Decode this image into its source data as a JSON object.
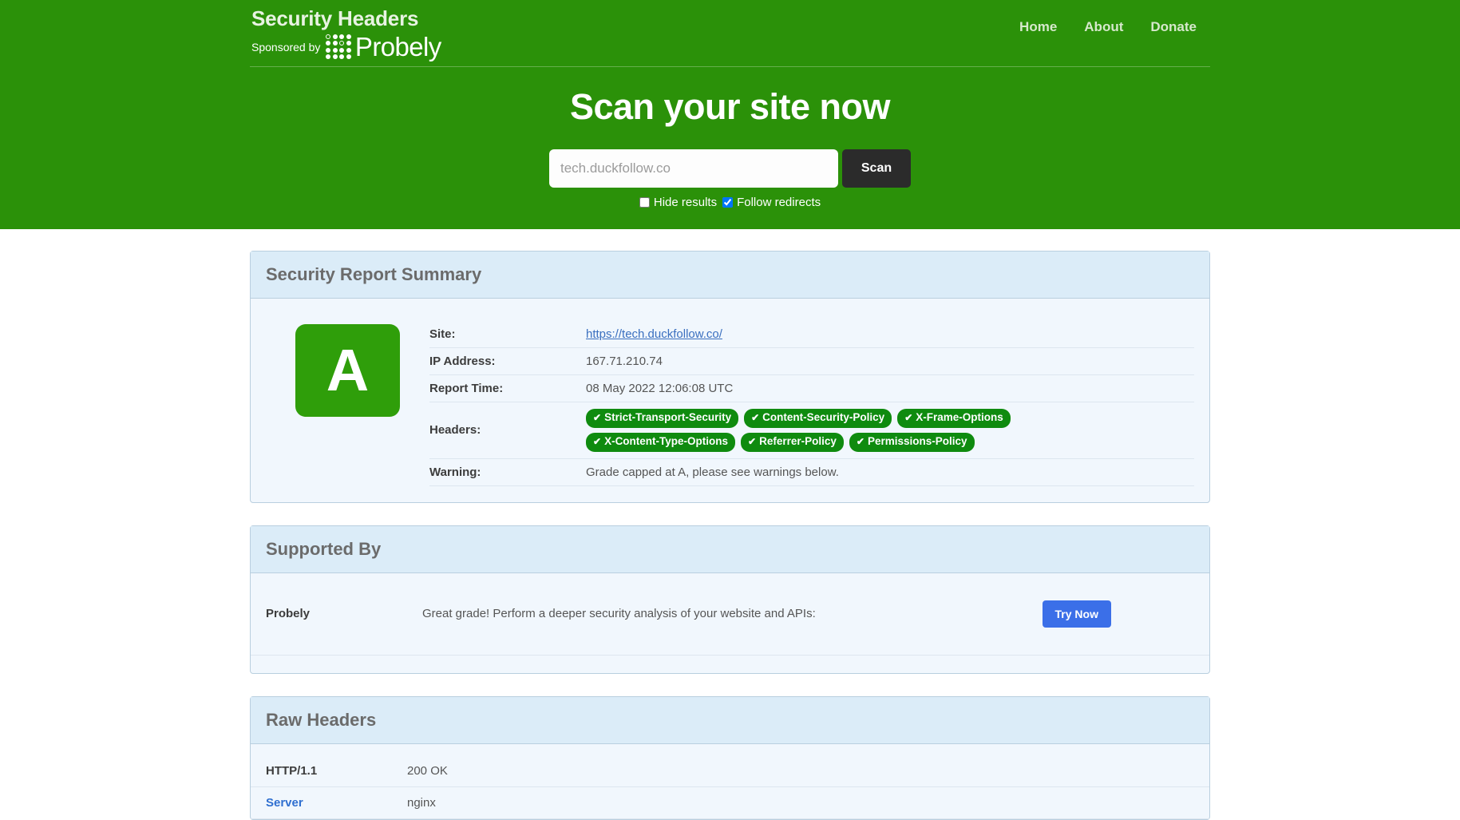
{
  "header": {
    "brand_title": "Security Headers",
    "sponsor_label": "Sponsored by",
    "sponsor_brand": "Probely",
    "nav": [
      {
        "label": "Home"
      },
      {
        "label": "About"
      },
      {
        "label": "Donate"
      }
    ],
    "heading": "Scan your site now",
    "search": {
      "value": "",
      "placeholder": "tech.duckfollow.co",
      "button_label": "Scan"
    },
    "options": [
      {
        "label": "Hide results",
        "checked": false
      },
      {
        "label": "Follow redirects",
        "checked": true
      }
    ],
    "bg_color": "#2b9109"
  },
  "summary_panel": {
    "title": "Security Report Summary",
    "grade": "A",
    "grade_color": "#2f9e0a",
    "rows": [
      {
        "key": "Site:",
        "value": "https://tech.duckfollow.co/",
        "is_link": true
      },
      {
        "key": "IP Address:",
        "value": "167.71.210.74",
        "is_link": false
      },
      {
        "key": "Report Time:",
        "value": "08 May 2022 12:06:08 UTC",
        "is_link": false
      }
    ],
    "headers_key": "Headers:",
    "header_badges": [
      "Strict-Transport-Security",
      "Content-Security-Policy",
      "X-Frame-Options",
      "X-Content-Type-Options",
      "Referrer-Policy",
      "Permissions-Policy"
    ],
    "badge_color": "#0f8b0f",
    "badge_tick": "✔",
    "warning_key": "Warning:",
    "warning_value": "Grade capped at A, please see warnings below."
  },
  "supported_panel": {
    "title": "Supported By",
    "sponsor_name": "Probely",
    "sponsor_description": "Great grade! Perform a deeper security analysis of your website and APIs:",
    "cta_label": "Try Now",
    "cta_color": "#3b6fe8"
  },
  "raw_headers_panel": {
    "title": "Raw Headers",
    "rows": [
      {
        "key": "HTTP/1.1",
        "value": "200 OK",
        "key_is_link": false
      },
      {
        "key": "Server",
        "value": "nginx",
        "key_is_link": true
      }
    ]
  }
}
